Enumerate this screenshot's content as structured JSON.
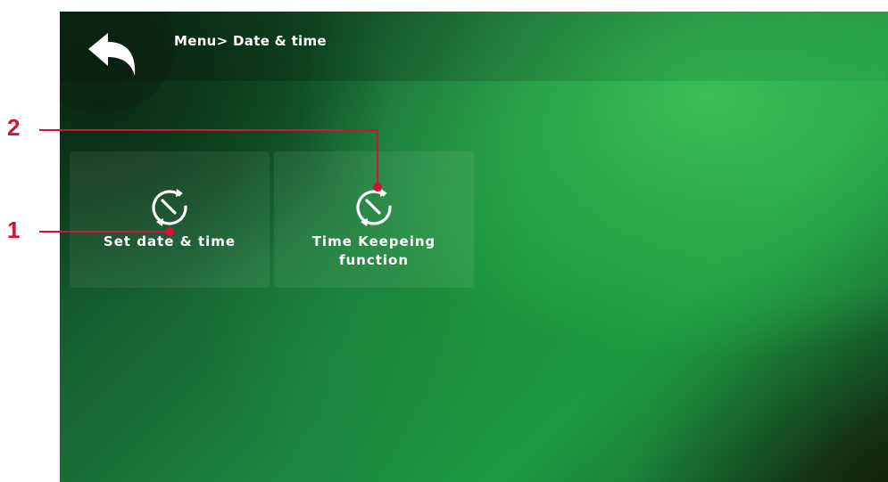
{
  "header": {
    "breadcrumb": "Menu> Date & time",
    "back_icon": "back-arrow-icon"
  },
  "tiles": [
    {
      "label": "Set date & time",
      "icon": "clock-sync-icon"
    },
    {
      "label": "Time Keepeing\nfunction",
      "icon": "clock-sync-icon"
    }
  ],
  "callouts": [
    {
      "number": "1"
    },
    {
      "number": "2"
    }
  ],
  "colors": {
    "callout": "#d01435",
    "text": "#ffffff",
    "background": "#1f8a40"
  }
}
